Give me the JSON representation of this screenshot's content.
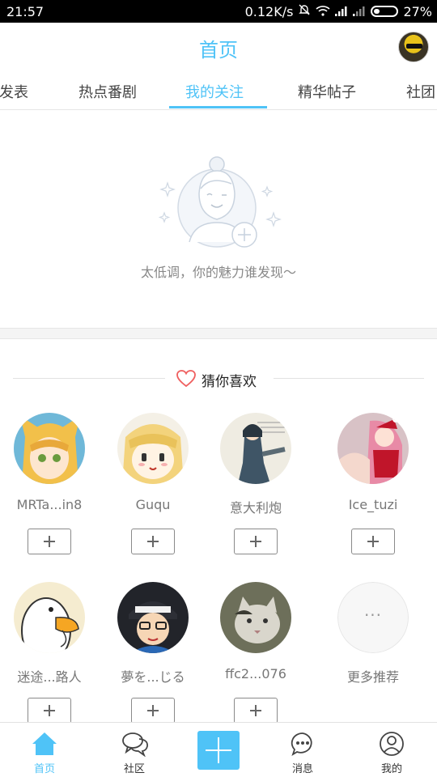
{
  "status_bar": {
    "time": "21:57",
    "network_speed": "0.12K/s",
    "battery": "27%",
    "battery_level": 0.27,
    "icons": [
      "mute-icon",
      "wifi-icon",
      "signal-icon",
      "signal-icon-2",
      "battery-icon"
    ]
  },
  "header": {
    "title": "首页",
    "avatar_icon": "user-avatar"
  },
  "tabs": [
    {
      "label": "发表"
    },
    {
      "label": "热点番剧"
    },
    {
      "label": "我的关注",
      "active": true
    },
    {
      "label": "精华帖子"
    },
    {
      "label": "社团"
    }
  ],
  "empty_state": {
    "message": "太低调，你的魅力谁发现～"
  },
  "recommend": {
    "title": "猜你喜欢",
    "users": [
      {
        "name": "MRTa...in8",
        "add_icon": "plus-icon"
      },
      {
        "name": "Guqu",
        "add_icon": "plus-icon"
      },
      {
        "name": "意大利炮",
        "add_icon": "plus-icon"
      },
      {
        "name": "Ice_tuzi",
        "add_icon": "plus-icon"
      },
      {
        "name": "迷途...路人",
        "add_icon": "plus-icon"
      },
      {
        "name": "夢を...じる",
        "add_icon": "plus-icon"
      },
      {
        "name": "ffc2...076",
        "add_icon": "plus-icon"
      }
    ],
    "more": {
      "label": "更多推荐",
      "dots": "···"
    }
  },
  "bottom_nav": {
    "items": [
      {
        "label": "首页",
        "icon": "home-icon",
        "active": true
      },
      {
        "label": "社区",
        "icon": "chat-bubbles-icon"
      },
      {
        "label": "",
        "icon": "plus-icon"
      },
      {
        "label": "消息",
        "icon": "message-icon"
      },
      {
        "label": "我的",
        "icon": "profile-icon"
      }
    ]
  },
  "colors": {
    "accent": "#4fc3f7",
    "text": "#444444",
    "muted": "#888888"
  }
}
